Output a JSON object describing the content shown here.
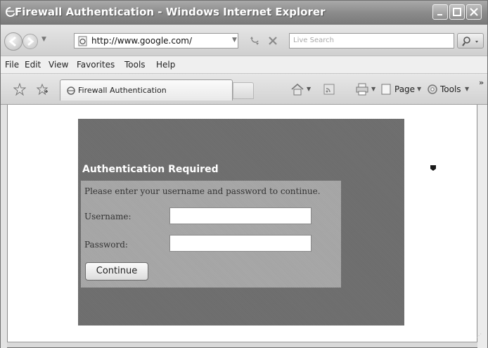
{
  "window": {
    "title": "Firewall Authentication - Windows Internet Explorer"
  },
  "address_bar": {
    "url": "http://www.google.com/",
    "search_placeholder": "Live Search"
  },
  "menu": {
    "items": [
      "File",
      "Edit",
      "View",
      "Favorites",
      "Tools",
      "Help"
    ]
  },
  "tabs": {
    "active_label": "Firewall Authentication"
  },
  "command_bar": {
    "page_label": "Page",
    "tools_label": "Tools"
  },
  "auth": {
    "title": "Authentication Required",
    "instructions": "Please enter your username and password to continue.",
    "username_label": "Username:",
    "username_value": "",
    "password_label": "Password:",
    "password_value": "",
    "continue_label": "Continue"
  }
}
